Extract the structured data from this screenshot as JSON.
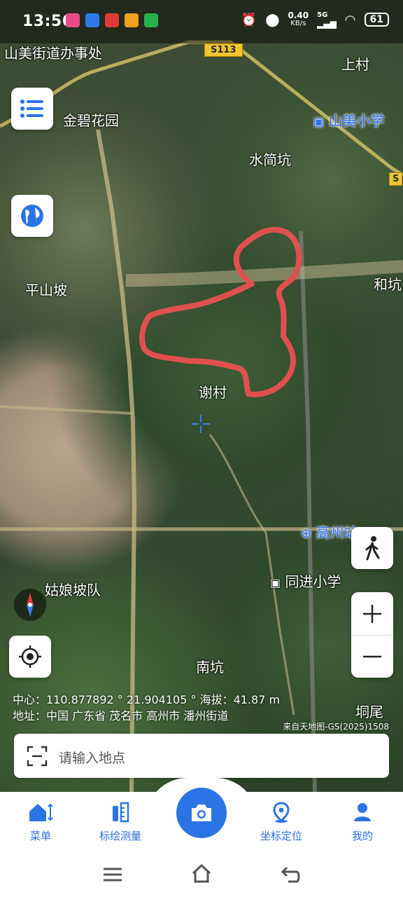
{
  "status": {
    "time": "13:56",
    "network_speed": "0.40",
    "network_unit": "KB/s",
    "signal": "5G",
    "battery": "61"
  },
  "map": {
    "labels": {
      "shanmei_office": "山美街道办事处",
      "jinbi_garden": "金碧花园",
      "shangcun": "上村",
      "shanmei_school": "山美小学",
      "shuitongkeng": "水简坑",
      "pingshanpo": "平山坡",
      "hekeng": "和坑",
      "xiecun": "谢村",
      "gaozhou_station": "高州站",
      "tongjin_school": "同进小学",
      "guniangpo": "姑娘坡队",
      "nankeng": "南坑",
      "dongwei": "垌尾"
    },
    "road_tags": {
      "s113": "S113",
      "s_right": "S"
    },
    "info": {
      "center_line": "中心：110.877892 ° 21.904105 ° 海拔：41.87 m",
      "address_line": "地址：中国 广东省 茂名市 高州市 潘州街道",
      "source": "来自天地图-GS(2025)1508"
    }
  },
  "search": {
    "placeholder": "请输入地点"
  },
  "nav": {
    "menu": "菜单",
    "measure": "标绘测量",
    "locate": "坐标定位",
    "mine": "我的"
  },
  "colors": {
    "accent": "#2b74e6",
    "track": "#e05050"
  }
}
